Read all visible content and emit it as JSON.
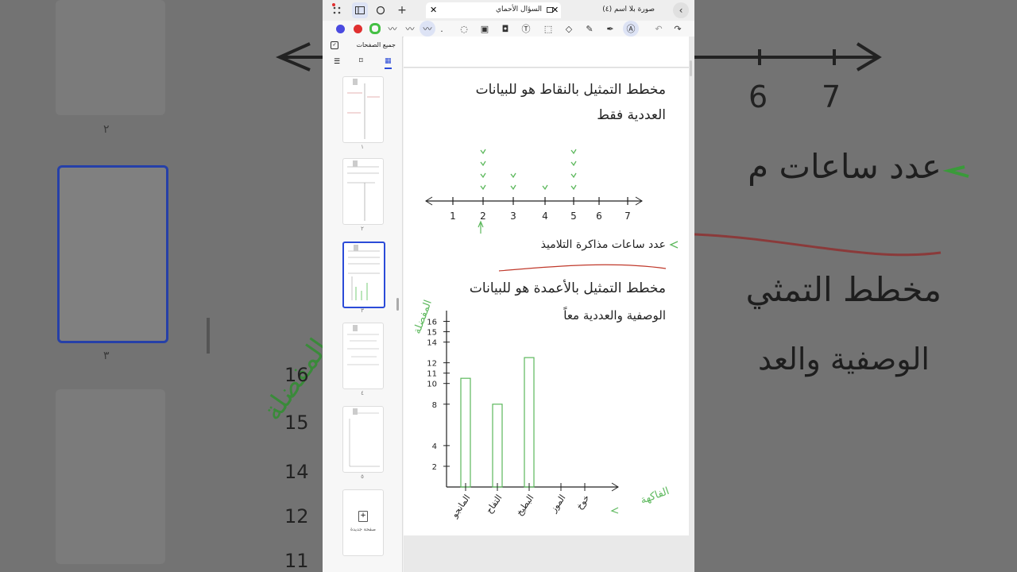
{
  "tabs": [
    {
      "label": "صورة بلا اسم (٤)"
    },
    {
      "label": "السؤال الأحماي"
    }
  ],
  "sidebar": {
    "title": "جميع الصفحات",
    "pages": [
      {
        "num": "١"
      },
      {
        "num": "٢"
      },
      {
        "num": "٣"
      },
      {
        "num": "٤"
      },
      {
        "num": "٥"
      }
    ],
    "new_page_label": "صفحة جديدة"
  },
  "colors": {
    "pen_blue": "#4a4ae0",
    "pen_red": "#e03030",
    "pen_green": "#44c044",
    "selected": "#2b4bd8",
    "accent_line": "#c0392b",
    "green_ink": "#5cb85c"
  },
  "note": {
    "heading1_line1": "مخطط التمثيل بالنقاط هو للبيانات",
    "heading1_line2": "العددية فقط",
    "dotplot_labels": [
      "1",
      "2",
      "3",
      "4",
      "5",
      "6",
      "7"
    ],
    "dotplot_caption": "عدد ساعات مذاكرة التلاميذ",
    "heading2_line1": "مخطط التمثيل بالأعمدة هو للبيانات",
    "heading2_line2": "الوصفية والعددية معاً",
    "y_axis_title": "المفضلة",
    "y_ticks": [
      "16",
      "15",
      "14",
      "12",
      "11",
      "10",
      "8",
      "4",
      "2"
    ],
    "x_categories": [
      "المانجو",
      "التفاح",
      "البطيخ",
      "الموز",
      "خوخ"
    ],
    "x_axis_title": "الفاكهة"
  },
  "bg": {
    "right_text1": "عدد ساعات م",
    "right_text2": "مخطط التمثي",
    "right_text3": "الوصفية والعد",
    "right_nums": [
      "6",
      "7"
    ],
    "left_nums": [
      "16",
      "15",
      "14",
      "12",
      "11"
    ],
    "left_labels": [
      "٢",
      "٣"
    ],
    "left_green": "المفضلة"
  }
}
